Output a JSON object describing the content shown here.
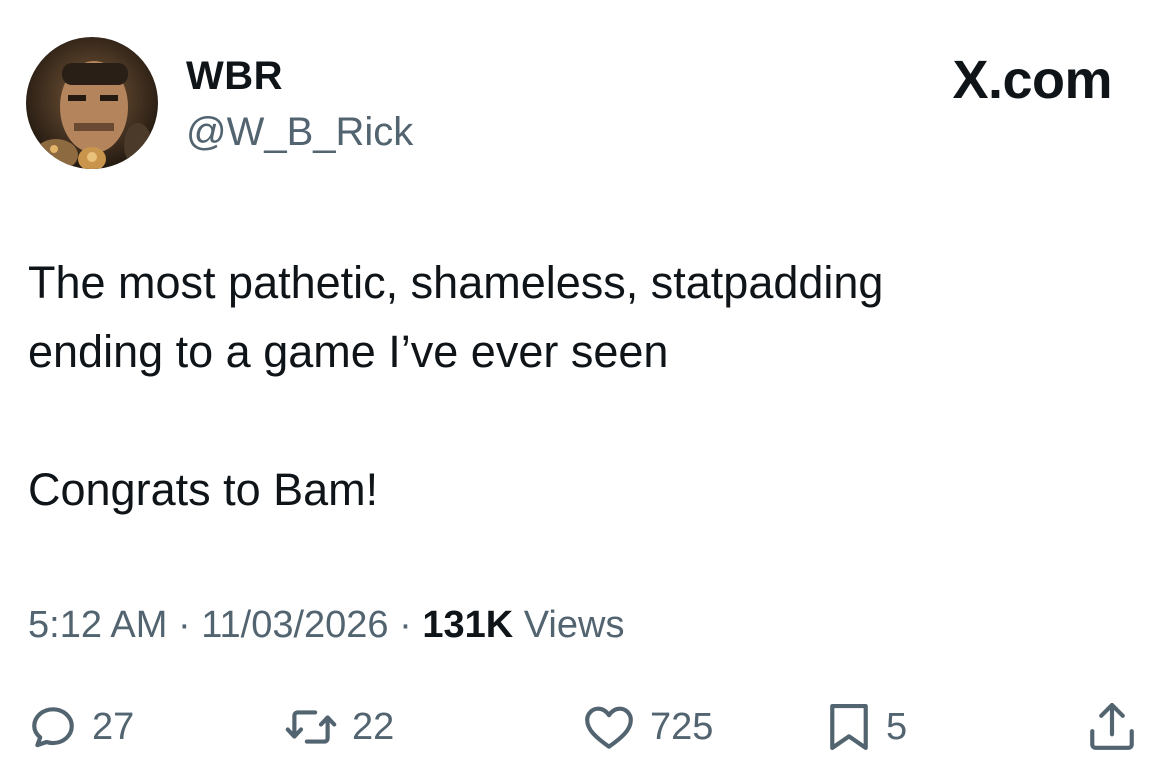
{
  "author": {
    "display_name": "WBR",
    "handle": "@W_B_Rick",
    "avatar_icon": "profile-photo"
  },
  "brand": {
    "label": "X.com"
  },
  "tweet": {
    "text": "The most pathetic, shameless, statpadding\nending to a game I’ve ever seen\n\nCongrats to Bam!"
  },
  "meta": {
    "time": "5:12 AM",
    "separator": " · ",
    "date": "11/03/2026",
    "views_count": "131K",
    "views_label": " Views"
  },
  "actions": {
    "replies": {
      "icon": "reply-icon",
      "count": "27"
    },
    "reposts": {
      "icon": "repost-icon",
      "count": "22"
    },
    "likes": {
      "icon": "heart-icon",
      "count": "725"
    },
    "bookmarks": {
      "icon": "bookmark-icon",
      "count": "5"
    },
    "share": {
      "icon": "share-icon"
    }
  },
  "colors": {
    "text_primary": "#0f1419",
    "text_secondary": "#536471",
    "background": "#ffffff"
  }
}
